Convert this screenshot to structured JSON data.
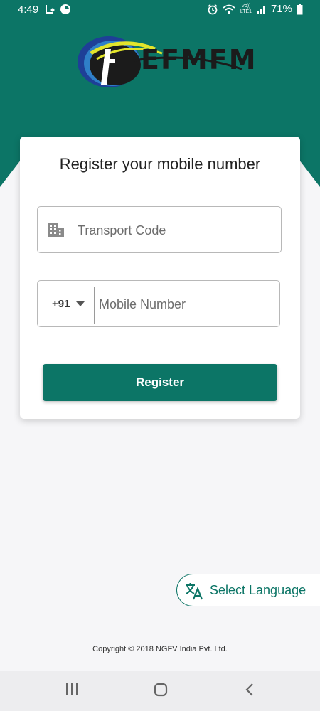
{
  "status_bar": {
    "time": "4:49",
    "battery": "71%",
    "left_icons": [
      "call-forwarding-icon",
      "app-notification-icon"
    ],
    "right_icons": [
      "alarm-icon",
      "wifi-icon",
      "volte-icon",
      "signal-icon",
      "battery-icon"
    ],
    "volte_text": "Vo))\nLTE1"
  },
  "brand": {
    "logo_text": "EFMFM",
    "accent_color": "#0c7566"
  },
  "card": {
    "title": "Register your mobile number",
    "transport_field": {
      "placeholder": "Transport Code",
      "value": "",
      "icon": "building-icon"
    },
    "mobile_field": {
      "country_code": "+91",
      "placeholder": "Mobile Number",
      "value": ""
    },
    "register_label": "Register"
  },
  "language": {
    "label": "Select Language",
    "icon": "translate-icon"
  },
  "footer": {
    "copyright": "Copyright © 2018 NGFV India Pvt. Ltd."
  },
  "nav_bar": {
    "buttons": [
      "recent-apps-icon",
      "home-icon",
      "back-icon"
    ]
  }
}
